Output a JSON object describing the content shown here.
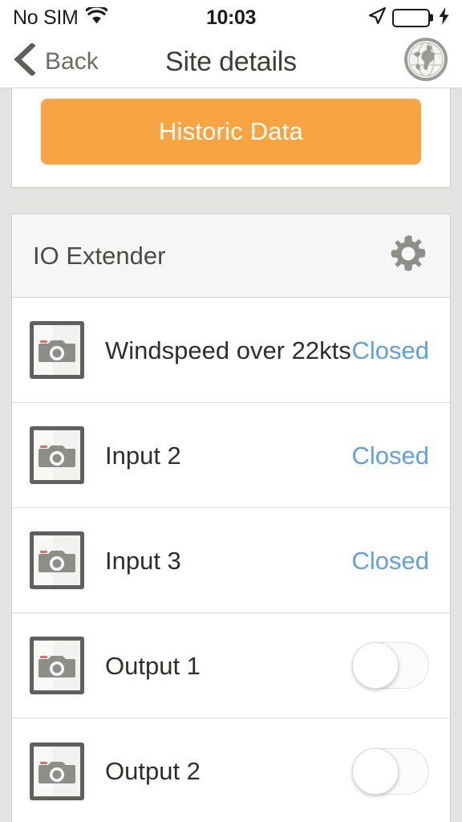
{
  "status_bar": {
    "carrier": "No SIM",
    "wifi_icon": "wifi-icon",
    "time": "10:03",
    "location_icon": "location-arrow-icon",
    "battery_icon": "battery-icon",
    "battery_level_percent": 100,
    "charging_icon": "lightning-bolt-icon",
    "battery_color": "#4cd964"
  },
  "nav_bar": {
    "back_icon": "chevron-left-icon",
    "back_label": "Back",
    "title": "Site details",
    "globe_icon": "globe-icon"
  },
  "historic_card": {
    "button_label": "Historic Data",
    "button_color": "#f9a443",
    "button_text_color": "#ffffff"
  },
  "io_section": {
    "title": "IO Extender",
    "gear_icon": "gear-icon",
    "rows": [
      {
        "thumb_icon": "camera-placeholder-icon",
        "label": "Windspeed over 22kts",
        "control": "status",
        "status": "Closed",
        "status_color": "#629fe2"
      },
      {
        "thumb_icon": "camera-placeholder-icon",
        "label": "Input 2",
        "control": "status",
        "status": "Closed",
        "status_color": "#629fe2"
      },
      {
        "thumb_icon": "camera-placeholder-icon",
        "label": "Input 3",
        "control": "status",
        "status": "Closed",
        "status_color": "#629fe2"
      },
      {
        "thumb_icon": "camera-placeholder-icon",
        "label": "Output 1",
        "control": "toggle",
        "toggle_on": false
      },
      {
        "thumb_icon": "camera-placeholder-icon",
        "label": "Output 2",
        "control": "toggle",
        "toggle_on": false
      }
    ]
  },
  "theme": {
    "page_background": "#e3e3e1",
    "card_background": "#ffffff",
    "section_header_background": "#f6f6f6",
    "separator": "#d9d9d7",
    "accent_orange": "#f9a443",
    "accent_blue": "#629fe2"
  }
}
